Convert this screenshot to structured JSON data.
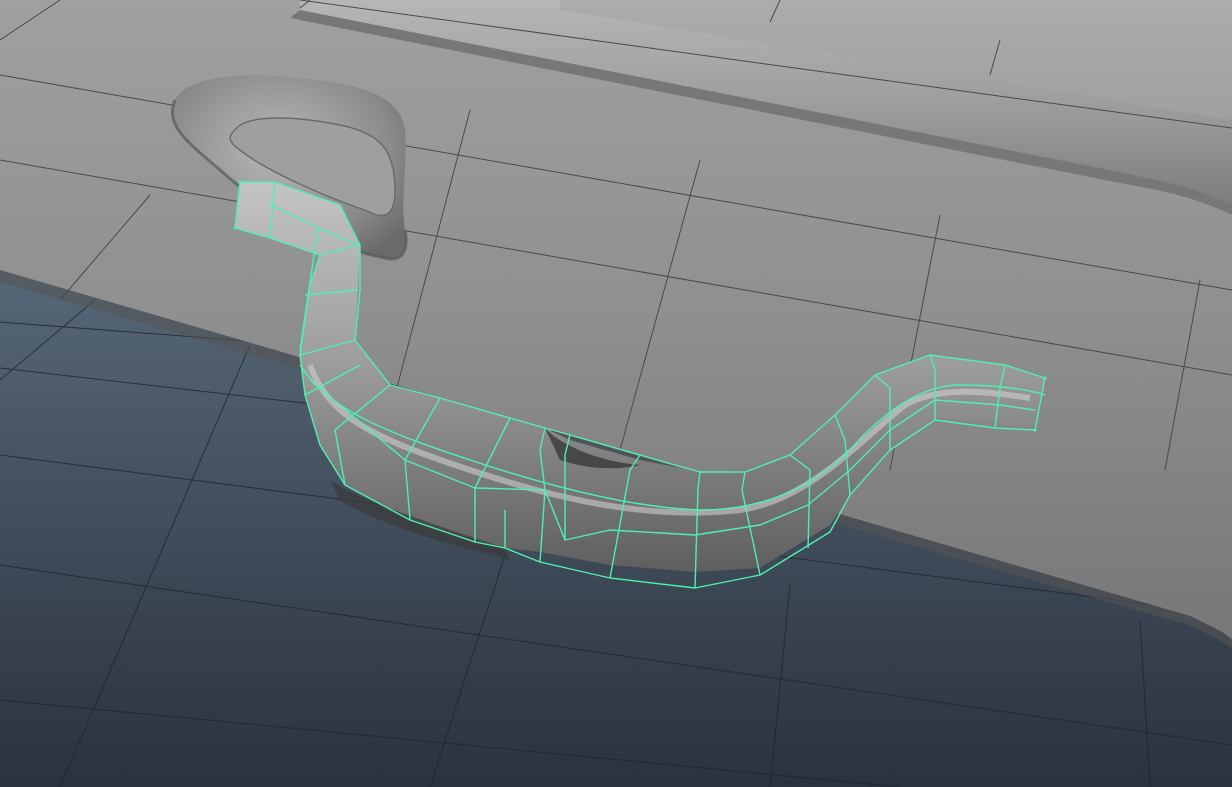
{
  "viewport": {
    "selection_wire_color": "#4ef0b0",
    "grid_line_color": "#1e2530",
    "background_top_color": "#6f8397",
    "background_bottom_color": "#2a323d",
    "surface_color": "#8d8d8d",
    "handle_color": "#9a9a9a"
  }
}
